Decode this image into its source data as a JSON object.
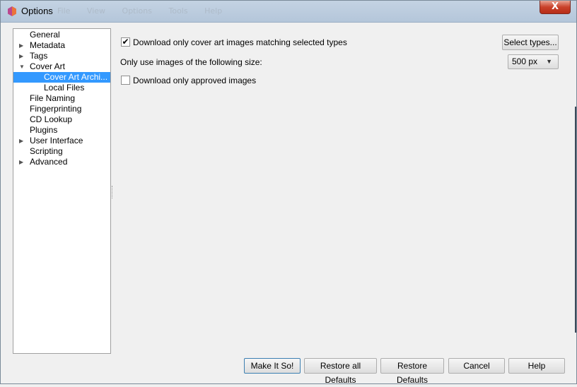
{
  "window": {
    "title": "Options",
    "ghost_menu": [
      "File",
      "View",
      "Options",
      "Tools",
      "Help"
    ],
    "close_label": "X"
  },
  "sidebar": {
    "items": [
      {
        "label": "General",
        "expand": ""
      },
      {
        "label": "Metadata",
        "expand": "collapsed"
      },
      {
        "label": "Tags",
        "expand": "collapsed"
      },
      {
        "label": "Cover Art",
        "expand": "expanded"
      },
      {
        "label": "Cover Art Archi...",
        "expand": "",
        "selected": true
      },
      {
        "label": "Local Files",
        "expand": ""
      },
      {
        "label": "File Naming",
        "expand": ""
      },
      {
        "label": "Fingerprinting",
        "expand": ""
      },
      {
        "label": "CD Lookup",
        "expand": ""
      },
      {
        "label": "Plugins",
        "expand": ""
      },
      {
        "label": "User Interface",
        "expand": "collapsed"
      },
      {
        "label": "Scripting",
        "expand": ""
      },
      {
        "label": "Advanced",
        "expand": "collapsed"
      }
    ]
  },
  "settings": {
    "download_matching": {
      "label": "Download only cover art images matching selected types",
      "checked": true
    },
    "select_types_label": "Select types...",
    "size_label": "Only use images of the following size:",
    "size_value": "500 px",
    "download_approved": {
      "label": "Download only approved images",
      "checked": false
    }
  },
  "footer": {
    "make_it_so": "Make It So!",
    "restore_all": "Restore all Defaults",
    "restore": "Restore Defaults",
    "cancel": "Cancel",
    "help": "Help"
  },
  "colors": {
    "selection": "#3399ff",
    "titlebar": "#b9cadd",
    "close_button": "#c9412a"
  }
}
